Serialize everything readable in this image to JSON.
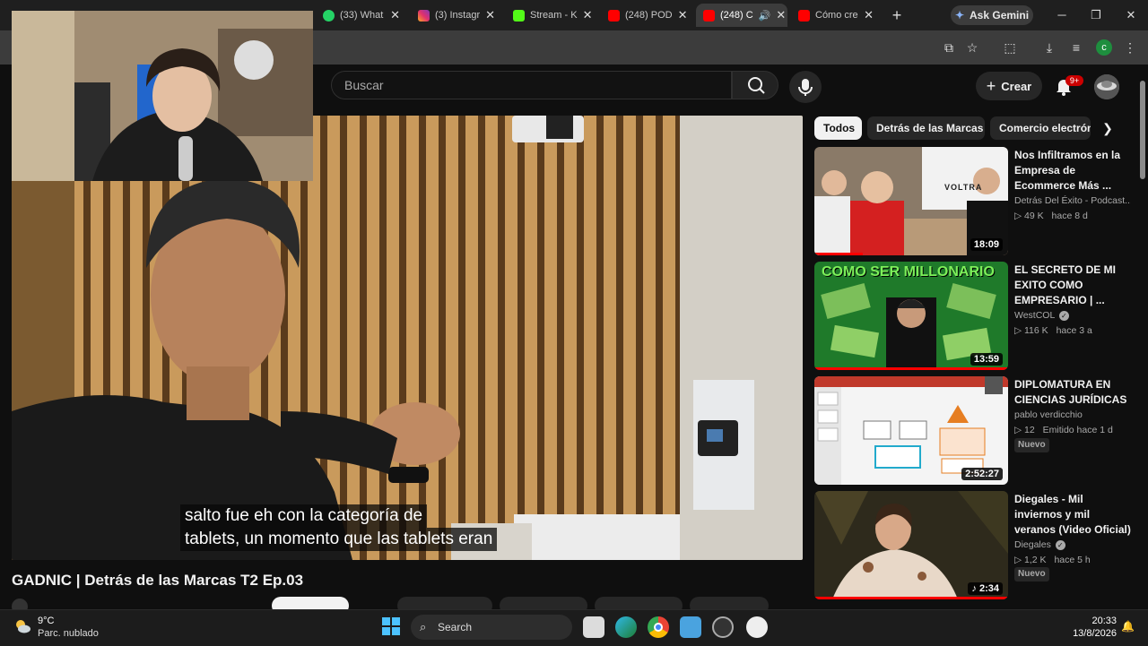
{
  "browser": {
    "tabs": [
      {
        "label": "(33) What",
        "icon": "whatsapp-icon",
        "color": "#25d366"
      },
      {
        "label": "(3) Instagr",
        "icon": "instagram-icon",
        "color": "#e1306c"
      },
      {
        "label": "Stream - K",
        "icon": "kick-icon",
        "color": "#53fc18"
      },
      {
        "label": "(248) POD",
        "icon": "youtube-icon",
        "color": "#ff0000"
      },
      {
        "label": "(248) C",
        "icon": "youtube-icon",
        "color": "#ff0000",
        "active": true
      },
      {
        "label": "Cómo cre",
        "icon": "youtube-icon",
        "color": "#ff0000"
      }
    ],
    "new_tab": "+",
    "gemini_label": "Ask Gemini",
    "profile_letter": "c"
  },
  "youtube": {
    "search_placeholder": "Buscar",
    "create_label": "Crear",
    "notif_badge": "9+"
  },
  "video": {
    "subtitle_line1": "salto fue eh con la categoría de",
    "subtitle_line2": "tablets, un momento que las tablets eran",
    "title": "GADNIC | Detrás de las Marcas T2 Ep.03"
  },
  "chips": [
    "Todos",
    "Detrás de las Marcas",
    "Comercio electrón"
  ],
  "recommendations": [
    {
      "title": "Nos Infiltramos en la Empresa de Ecommerce Más ...",
      "channel": "Detrás Del Éxito - Podcast...",
      "views": "49 K",
      "age": "hace 8 d",
      "duration": "18:09",
      "progress": 0.25
    },
    {
      "title": "EL SECRETO DE MI EXITO COMO EMPRESARIO | ...",
      "channel": "WestCOL",
      "verified": true,
      "views": "116 K",
      "age": "hace 3 a",
      "duration": "13:59",
      "progress": 1.0
    },
    {
      "title": "DIPLOMATURA EN CIENCIAS JURÍDICAS",
      "channel": "pablo verdicchio",
      "views": "12",
      "age": "Emitido hace 1 d",
      "duration": "2:52:27",
      "badge": "Nuevo"
    },
    {
      "title": "Diegales - Mil inviernos y mil veranos (Video Oficial)",
      "channel": "Diegales",
      "verified": true,
      "views": "1,2 K",
      "age": "hace 5 h",
      "duration": "2:34",
      "badge": "Nuevo",
      "progress": 1.0
    }
  ],
  "rec_overlays": {
    "thumb1_text": "VOLTRA",
    "thumb2_text": "COMO SER MILLONARIO"
  },
  "taskbar": {
    "temp": "9°C",
    "weather": "Parc. nublado",
    "search_label": "Search",
    "time": "20:33",
    "date": "13/8/2026"
  }
}
